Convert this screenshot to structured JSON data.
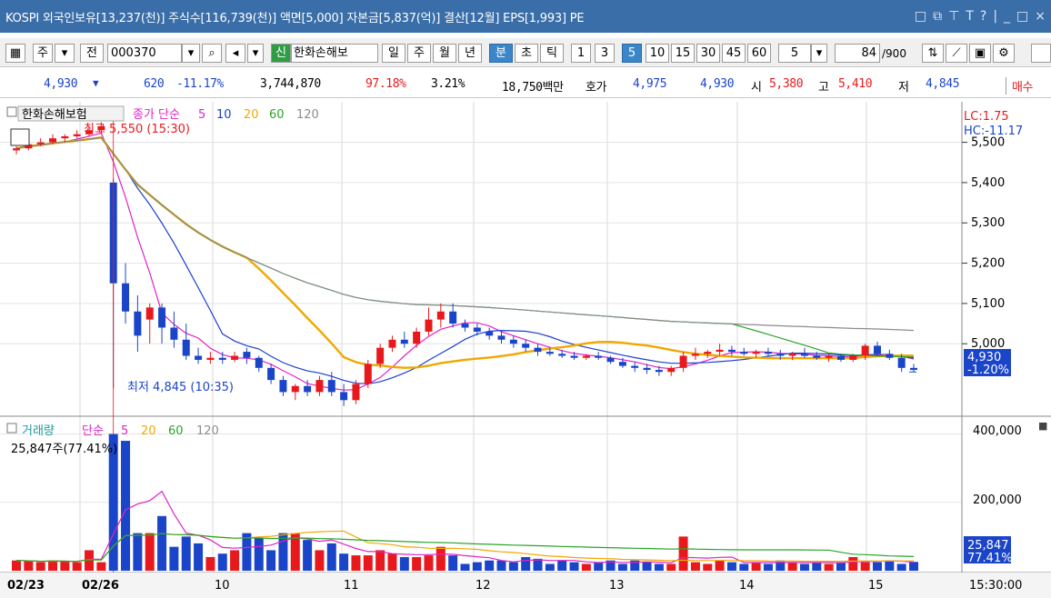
{
  "title": "KOSPI 외국인보유[13,237(천)] 주식수[116,739(천)] 액면[5,000] 자본금[5,837(억)] 결산[12월] EPS[1,993] PE",
  "window_icons": [
    "□",
    "⧉",
    "⊤",
    "T",
    "?",
    "|",
    "_",
    "□",
    "×"
  ],
  "toolbar": {
    "period_1": "주",
    "prev": "전",
    "code": "000370",
    "search_icon": "search-icon",
    "speaker_icon": "speaker-icon",
    "new_badge": "신",
    "stock_name": "한화손해보",
    "periods": [
      "일",
      "주",
      "월",
      "년",
      "분",
      "초",
      "틱"
    ],
    "active_period": "분",
    "intervals": [
      "1",
      "3",
      "5",
      "10",
      "15",
      "30",
      "45",
      "60"
    ],
    "active_interval": "5",
    "interval_select": "5",
    "count": "84",
    "count_max": "/900"
  },
  "infobar": {
    "price": "4,930",
    "change": "620",
    "change_pct": "-11.17%",
    "volume": "3,744,870",
    "vol_ratio": "97.18%",
    "turnover": "3.21%",
    "amount": "18,750백만",
    "quote_label": "호가",
    "ask": "4,975",
    "bid": "4,930",
    "open_label": "시",
    "open": "5,380",
    "high_label": "고",
    "high": "5,410",
    "low_label": "저",
    "low": "4,845",
    "buy": "매수"
  },
  "price_panel": {
    "stock_label": "한화손해보험",
    "ma_label": "종가 단순",
    "ma_periods": [
      "5",
      "10",
      "20",
      "60",
      "120"
    ],
    "high_marker": "최고 5,550 (15:30)",
    "low_marker": "최저 4,845 (10:35)",
    "lc": "LC:1.75",
    "hc": "HC:-11.17",
    "y_ticks": [
      "5,500",
      "5,400",
      "5,300",
      "5,200",
      "5,100",
      "5,000"
    ],
    "current_price": "4,930",
    "current_pct": "-1.20%"
  },
  "volume_panel": {
    "label": "거래량",
    "ma_label": "단순",
    "ma_periods": [
      "5",
      "20",
      "60",
      "120"
    ],
    "current": "25,847주(77.41%)",
    "y_ticks": [
      "400,000",
      "200,000"
    ],
    "cur_val": "25,847",
    "cur_pct": "77.41%"
  },
  "x_labels": [
    "02/23",
    "02/26",
    "10",
    "11",
    "12",
    "13",
    "14",
    "15"
  ],
  "time_label": "15:30:00",
  "colors": {
    "up": "#e8191d",
    "down": "#1b45c9",
    "ma5": "#e022c8",
    "ma10": "#1b3fd0",
    "ma20": "#f0a800",
    "ma60": "#2aa52a",
    "ma120": "#8c8c8c",
    "title": "#3a6ea8"
  },
  "chart_data": {
    "type": "candlestick",
    "candles": [
      [
        5480,
        5490,
        5470,
        5485
      ],
      [
        5485,
        5500,
        5480,
        5495
      ],
      [
        5495,
        5510,
        5490,
        5500
      ],
      [
        5500,
        5520,
        5495,
        5510
      ],
      [
        5510,
        5520,
        5500,
        5515
      ],
      [
        5515,
        5530,
        5510,
        5520
      ],
      [
        5520,
        5540,
        5515,
        5530
      ],
      [
        5530,
        5550,
        5520,
        5540
      ],
      [
        5400,
        5410,
        4890,
        5150
      ],
      [
        5150,
        5200,
        5050,
        5080
      ],
      [
        5080,
        5120,
        4980,
        5020
      ],
      [
        5060,
        5100,
        5000,
        5090
      ],
      [
        5090,
        5100,
        5000,
        5040
      ],
      [
        5040,
        5080,
        4990,
        5010
      ],
      [
        5010,
        5050,
        4960,
        4970
      ],
      [
        4970,
        4990,
        4950,
        4960
      ],
      [
        4960,
        4980,
        4950,
        4965
      ],
      [
        4965,
        4980,
        4950,
        4960
      ],
      [
        4960,
        4980,
        4955,
        4970
      ],
      [
        4980,
        4990,
        4950,
        4965
      ],
      [
        4965,
        4970,
        4930,
        4940
      ],
      [
        4940,
        4950,
        4900,
        4910
      ],
      [
        4910,
        4920,
        4870,
        4880
      ],
      [
        4880,
        4900,
        4860,
        4895
      ],
      [
        4895,
        4910,
        4870,
        4880
      ],
      [
        4880,
        4920,
        4870,
        4910
      ],
      [
        4910,
        4930,
        4870,
        4880
      ],
      [
        4880,
        4900,
        4845,
        4860
      ],
      [
        4860,
        4910,
        4850,
        4900
      ],
      [
        4900,
        4960,
        4890,
        4950
      ],
      [
        4950,
        5000,
        4940,
        4990
      ],
      [
        4990,
        5020,
        4980,
        5010
      ],
      [
        5010,
        5030,
        4990,
        5000
      ],
      [
        5000,
        5040,
        4990,
        5030
      ],
      [
        5030,
        5090,
        5020,
        5060
      ],
      [
        5060,
        5100,
        5040,
        5080
      ],
      [
        5080,
        5100,
        5040,
        5050
      ],
      [
        5050,
        5060,
        5030,
        5040
      ],
      [
        5040,
        5050,
        5020,
        5030
      ],
      [
        5030,
        5040,
        5010,
        5020
      ],
      [
        5020,
        5030,
        5000,
        5010
      ],
      [
        5010,
        5020,
        4990,
        5000
      ],
      [
        5000,
        5010,
        4980,
        4990
      ],
      [
        4990,
        5000,
        4970,
        4980
      ],
      [
        4980,
        4990,
        4970,
        4975
      ],
      [
        4975,
        4985,
        4965,
        4970
      ],
      [
        4970,
        4980,
        4960,
        4965
      ],
      [
        4965,
        4975,
        4960,
        4970
      ],
      [
        4970,
        4980,
        4960,
        4965
      ],
      [
        4965,
        4970,
        4950,
        4955
      ],
      [
        4955,
        4965,
        4940,
        4945
      ],
      [
        4945,
        4955,
        4930,
        4940
      ],
      [
        4940,
        4950,
        4925,
        4935
      ],
      [
        4935,
        4945,
        4920,
        4930
      ],
      [
        4930,
        4945,
        4920,
        4940
      ],
      [
        4940,
        4980,
        4930,
        4970
      ],
      [
        4970,
        4990,
        4960,
        4975
      ],
      [
        4975,
        4985,
        4965,
        4980
      ],
      [
        4980,
        5000,
        4970,
        4985
      ],
      [
        4985,
        4995,
        4970,
        4980
      ],
      [
        4980,
        4990,
        4970,
        4975
      ],
      [
        4975,
        4985,
        4965,
        4980
      ],
      [
        4980,
        4990,
        4970,
        4975
      ],
      [
        4975,
        4985,
        4960,
        4970
      ],
      [
        4970,
        4980,
        4960,
        4975
      ],
      [
        4975,
        4990,
        4965,
        4970
      ],
      [
        4970,
        4980,
        4960,
        4965
      ],
      [
        4965,
        4975,
        4955,
        4970
      ],
      [
        4970,
        4975,
        4955,
        4960
      ],
      [
        4960,
        4975,
        4955,
        4970
      ],
      [
        4970,
        5000,
        4960,
        4995
      ],
      [
        4995,
        5005,
        4970,
        4975
      ],
      [
        4975,
        4985,
        4960,
        4965
      ],
      [
        4965,
        4975,
        4930,
        4940
      ],
      [
        4940,
        4950,
        4930,
        4935
      ]
    ],
    "volumes": [
      30000,
      28000,
      25000,
      30000,
      27000,
      25000,
      60000,
      25000,
      400000,
      380000,
      110000,
      110000,
      160000,
      70000,
      100000,
      80000,
      40000,
      50000,
      60000,
      110000,
      95000,
      60000,
      110000,
      110000,
      90000,
      60000,
      80000,
      50000,
      45000,
      45000,
      60000,
      50000,
      40000,
      40000,
      45000,
      70000,
      45000,
      20000,
      25000,
      30000,
      30000,
      25000,
      40000,
      35000,
      20000,
      30000,
      25000,
      20000,
      25000,
      30000,
      20000,
      30000,
      25000,
      20000,
      20000,
      100000,
      25000,
      20000,
      30000,
      25000,
      20000,
      25000,
      20000,
      30000,
      25000,
      20000,
      25000,
      20000,
      25000,
      40000,
      25000,
      25000,
      30000,
      20000,
      25847
    ],
    "price_ylim": [
      4820,
      5560
    ],
    "volume_ylim": [
      0,
      420000
    ]
  }
}
